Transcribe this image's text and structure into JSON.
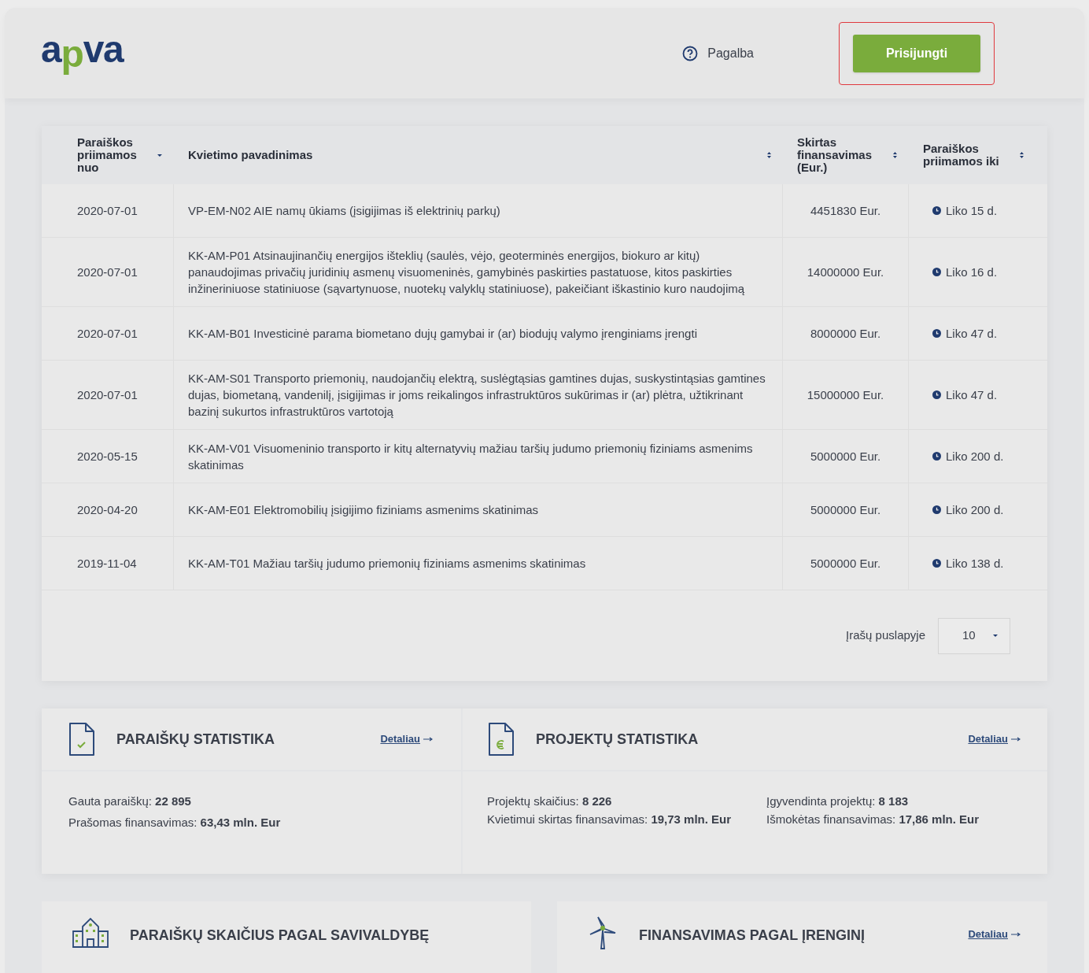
{
  "header": {
    "logo": {
      "part_1": "a",
      "part_2": "p",
      "part_3": "va"
    },
    "help_link": "Pagalba",
    "login_button": {
      "label": "Prisijungti",
      "highlighted": true
    }
  },
  "table": {
    "columns": [
      {
        "label": "Paraiškos priimamos nuo",
        "sorted": true
      },
      {
        "label": "Kvietimo pavadinimas",
        "sorted": false
      },
      {
        "label": "Skirtas finansavimas (Eur.)",
        "sorted": false
      },
      {
        "label": "Paraiškos priimamos iki",
        "sorted": false
      }
    ],
    "rows": [
      {
        "from": "2020-07-01",
        "name": "VP-EM-N02 AIE namų ūkiams (įsigijimas iš elektrinių parkų)",
        "amount": "4451830 Eur.",
        "remaining": "Liko 15 d."
      },
      {
        "from": "2020-07-01",
        "name": "KK-AM-P01 Atsinaujinančių energijos išteklių (saulės, vėjo, geoterminės energijos, biokuro ar kitų) panaudojimas privačių juridinių asmenų visuomeninės, gamybinės paskirties pastatuose, kitos paskirties inžineriniuose statiniuose (sąvartynuose, nuotekų valyklų statiniuose), pakeičiant iškastinio kuro naudojimą",
        "amount": "14000000 Eur.",
        "remaining": "Liko 16 d."
      },
      {
        "from": "2020-07-01",
        "name": "KK-AM-B01 Investicinė parama biometano dujų gamybai ir (ar) biodujų valymo įrenginiams įrengti",
        "amount": "8000000 Eur.",
        "remaining": "Liko 47 d."
      },
      {
        "from": "2020-07-01",
        "name": "KK-AM-S01 Transporto priemonių, naudojančių elektrą, suslėgtąsias gamtines dujas, suskystintąsias gamtines dujas, biometaną, vandenilį, įsigijimas ir joms reikalingos infrastruktūros sukūrimas ir (ar) plėtra, užtikrinant bazinį sukurtos infrastruktūros vartotoją",
        "amount": "15000000 Eur.",
        "remaining": "Liko 47 d."
      },
      {
        "from": "2020-05-15",
        "name": "KK-AM-V01 Visuomeninio transporto ir kitų alternatyvių mažiau taršių judumo priemonių fiziniams asmenims skatinimas",
        "amount": "5000000 Eur.",
        "remaining": "Liko 200 d."
      },
      {
        "from": "2020-04-20",
        "name": "KK-AM-E01 Elektromobilių įsigijimo fiziniams asmenims skatinimas",
        "amount": "5000000 Eur.",
        "remaining": "Liko 200 d."
      },
      {
        "from": "2019-11-04",
        "name": "KK-AM-T01 Mažiau taršių judumo priemonių fiziniams asmenims skatinimas",
        "amount": "5000000 Eur.",
        "remaining": "Liko 138 d."
      }
    ],
    "page_size": {
      "label": "Įrašų puslapyje",
      "value": "10"
    }
  },
  "stats": [
    {
      "kind": "applications",
      "title": "PARAIŠKŲ STATISTIKA",
      "link": "Detaliau",
      "lines": [
        "Gauta paraiškų: **22 895**",
        "Prašomas finansavimas: **63,43 mln. Eur**"
      ]
    },
    {
      "kind": "projects",
      "title": "PROJEKTŲ STATISTIKA",
      "link": "Detaliau",
      "lines": [
        "Projektų skaičius: **8 226**",
        "Kvietimui skirtas finansavimas: **19,73 mln. Eur**",
        "Įgyvendinta projektų: **8 183**",
        "Išmokėtas finansavimas: **17,86 mln. Eur**"
      ]
    }
  ],
  "bottom_cards": [
    {
      "kind": "buildings",
      "title": "PARAIŠKŲ SKAIČIUS PAGAL SAVIVALDYBĘ"
    },
    {
      "kind": "turbine",
      "title": "FINANSAVIMAS PAGAL ĮRENGINĮ",
      "link": "Detaliau"
    }
  ]
}
